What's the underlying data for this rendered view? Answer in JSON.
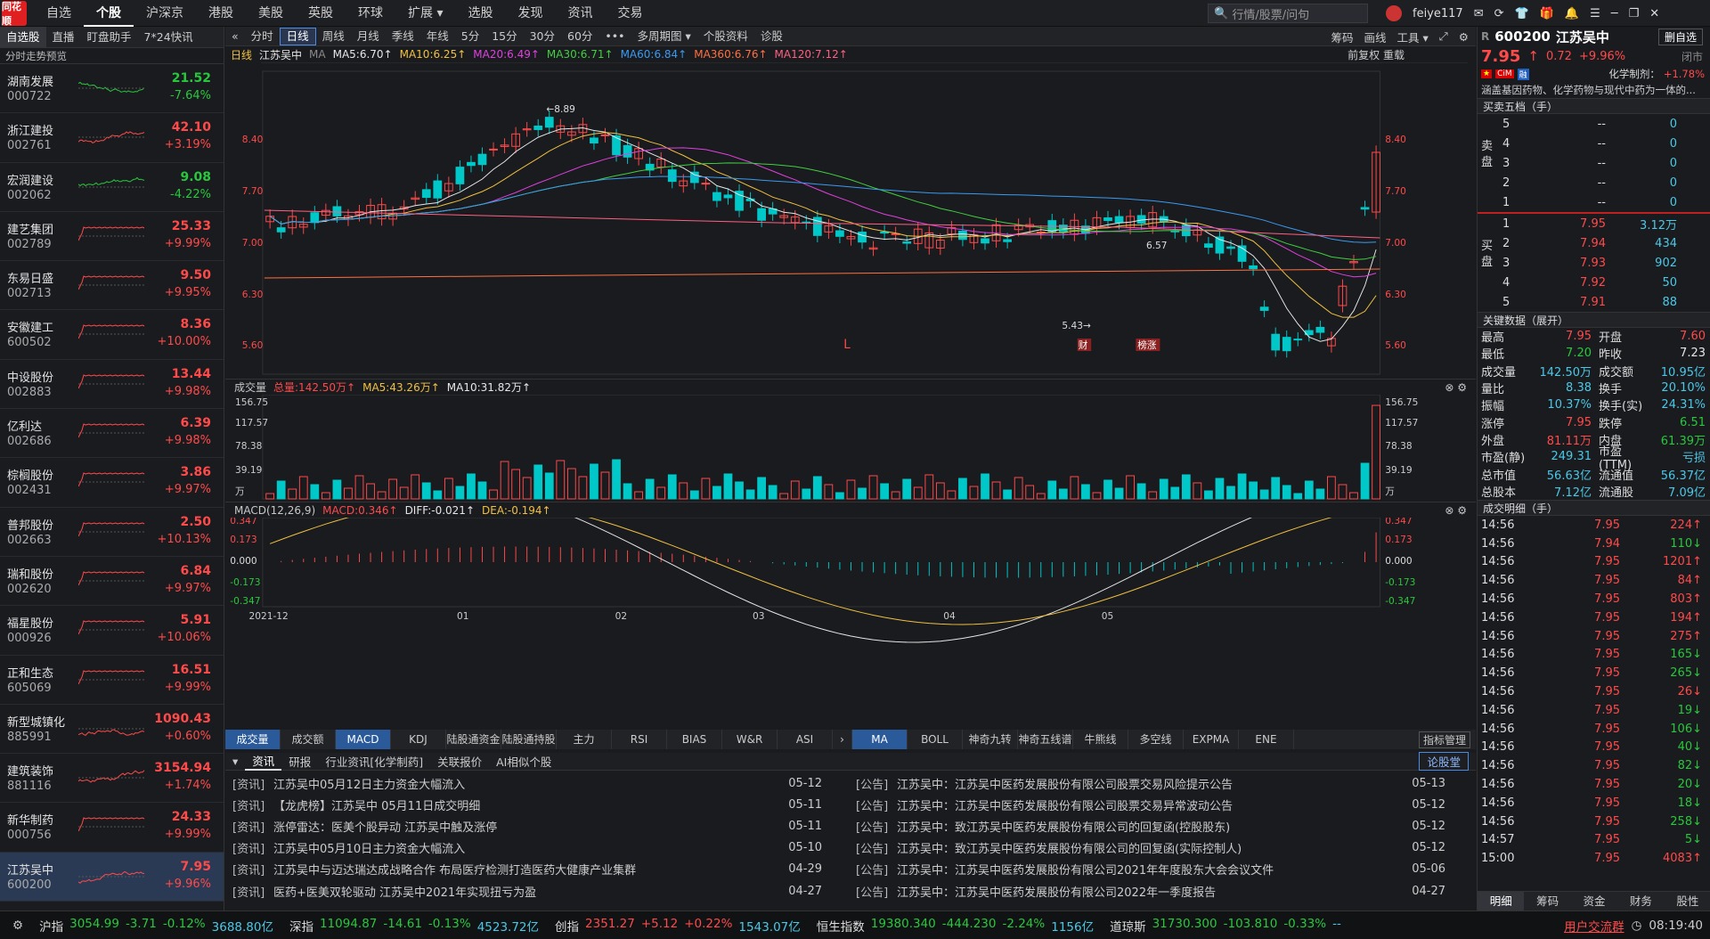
{
  "topbar": {
    "logo": "同花顺",
    "nav": [
      "自选",
      "个股",
      "沪深京",
      "港股",
      "美股",
      "英股",
      "环球",
      "扩展 ▾",
      "选股",
      "发现",
      "资讯",
      "交易"
    ],
    "search_placeholder": "行情/股票/问句",
    "user": "feiye117",
    "win_controls": [
      "─",
      "❐",
      "✕"
    ]
  },
  "left": {
    "tabs": [
      "自选股",
      "直播",
      "盯盘助手",
      "7*24快讯"
    ],
    "header": "分时走势预览",
    "stocks": [
      {
        "name": "湖南发展",
        "code": "000722",
        "price": "21.52",
        "pct": "-7.64%",
        "dir": "down"
      },
      {
        "name": "浙江建投",
        "code": "002761",
        "price": "42.10",
        "pct": "+3.19%",
        "dir": "up"
      },
      {
        "name": "宏润建设",
        "code": "002062",
        "price": "9.08",
        "pct": "-4.22%",
        "dir": "down"
      },
      {
        "name": "建艺集团",
        "code": "002789",
        "price": "25.33",
        "pct": "+9.99%",
        "dir": "up"
      },
      {
        "name": "东易日盛",
        "code": "002713",
        "price": "9.50",
        "pct": "+9.95%",
        "dir": "up"
      },
      {
        "name": "安徽建工",
        "code": "600502",
        "price": "8.36",
        "pct": "+10.00%",
        "dir": "up"
      },
      {
        "name": "中设股份",
        "code": "002883",
        "price": "13.44",
        "pct": "+9.98%",
        "dir": "up"
      },
      {
        "name": "亿利达",
        "code": "002686",
        "price": "6.39",
        "pct": "+9.98%",
        "dir": "up"
      },
      {
        "name": "棕榈股份",
        "code": "002431",
        "price": "3.86",
        "pct": "+9.97%",
        "dir": "up"
      },
      {
        "name": "普邦股份",
        "code": "002663",
        "price": "2.50",
        "pct": "+10.13%",
        "dir": "up"
      },
      {
        "name": "瑞和股份",
        "code": "002620",
        "price": "6.84",
        "pct": "+9.97%",
        "dir": "up"
      },
      {
        "name": "福星股份",
        "code": "000926",
        "price": "5.91",
        "pct": "+10.06%",
        "dir": "up"
      },
      {
        "name": "正和生态",
        "code": "605069",
        "price": "16.51",
        "pct": "+9.99%",
        "dir": "up"
      },
      {
        "name": "新型城镇化",
        "code": "885991",
        "price": "1090.43",
        "pct": "+0.60%",
        "dir": "up"
      },
      {
        "name": "建筑装饰",
        "code": "881116",
        "price": "3154.94",
        "pct": "+1.74%",
        "dir": "up"
      },
      {
        "name": "新华制药",
        "code": "000756",
        "price": "24.33",
        "pct": "+9.99%",
        "dir": "up"
      },
      {
        "name": "江苏吴中",
        "code": "600200",
        "price": "7.95",
        "pct": "+9.96%",
        "dir": "up"
      }
    ]
  },
  "center": {
    "periods": [
      "«",
      "分时",
      "日线",
      "周线",
      "月线",
      "季线",
      "年线",
      "5分",
      "15分",
      "30分",
      "60分",
      "•••",
      "多周期图 ▾",
      "个股资料",
      "诊股"
    ],
    "period_right": [
      "筹码",
      "画线",
      "工具 ▾",
      "⤢",
      "⚙"
    ],
    "ma_legend": {
      "type": "日线",
      "name": "江苏吴中",
      "ma": "MA",
      "ma5": "MA5:6.70↑",
      "ma10": "MA10:6.25↑",
      "ma20": "MA20:6.49↑",
      "ma30": "MA30:6.71↑",
      "ma60": "MA60:6.84↑",
      "ma360": "MA360:6.76↑",
      "ma120": "MA120:7.12↑",
      "right": "前复权  重载"
    },
    "price_ticks": [
      "8.40",
      "7.70",
      "7.00",
      "6.30",
      "5.60"
    ],
    "annotations": {
      "high": "←8.89",
      "low": "5.43→",
      "last": "6.57",
      "marker_l": "L",
      "tag_cai": "财",
      "tag_zt": "榜涨"
    },
    "vol_legend": {
      "name": "成交量",
      "total": "总量:142.50万↑",
      "ma5": "MA5:43.26万↑",
      "ma10": "MA10:31.82万↑"
    },
    "vol_ticks": [
      "156.75",
      "117.57",
      "78.38",
      "39.19",
      "万"
    ],
    "macd_legend": {
      "name": "MACD(12,26,9)",
      "macd": "MACD:0.346↑",
      "diff": "DIFF:-0.021↑",
      "dea": "DEA:-0.194↑"
    },
    "macd_ticks": [
      "0.347",
      "0.173",
      "0.000",
      "-0.173",
      "-0.347"
    ],
    "dates": [
      "2021-12",
      "01",
      "02",
      "03",
      "04",
      "05"
    ],
    "ind_tabs": [
      "成交量",
      "成交额",
      "MACD",
      "KDJ",
      "陆股通资金",
      "陆股通持股",
      "主力",
      "RSI",
      "BIAS",
      "W&R",
      "ASI",
      "›",
      "MA",
      "BOLL",
      "神奇九转",
      "神奇五线谱",
      "牛熊线",
      "多空线",
      "EXPMA",
      "ENE"
    ],
    "ind_manage": "指标管理",
    "news_tabs": [
      "资讯",
      "研报",
      "行业资讯[化学制药]",
      "关联报价",
      "AI相似个股"
    ],
    "news_btn": "论股堂",
    "news_left": [
      {
        "type": "[资讯]",
        "title": "江苏吴中05月12日主力资金大幅流入",
        "date": "05-12"
      },
      {
        "type": "[资讯]",
        "title": "【龙虎榜】江苏吴中 05月11日成交明细",
        "date": "05-11"
      },
      {
        "type": "[资讯]",
        "title": "涨停雷达：医美个股异动 江苏吴中触及涨停",
        "date": "05-11"
      },
      {
        "type": "[资讯]",
        "title": "江苏吴中05月10日主力资金大幅流入",
        "date": "05-10"
      },
      {
        "type": "[资讯]",
        "title": "江苏吴中与迈达瑞达成战略合作 布局医疗检测打造医药大健康产业集群",
        "date": "04-29"
      },
      {
        "type": "[资讯]",
        "title": "医药+医美双轮驱动 江苏吴中2021年实现扭亏为盈",
        "date": "04-27"
      }
    ],
    "news_right": [
      {
        "type": "[公告]",
        "title": "江苏吴中：江苏吴中医药发展股份有限公司股票交易风险提示公告",
        "date": "05-13"
      },
      {
        "type": "[公告]",
        "title": "江苏吴中：江苏吴中医药发展股份有限公司股票交易异常波动公告",
        "date": "05-12"
      },
      {
        "type": "[公告]",
        "title": "江苏吴中：致江苏吴中医药发展股份有限公司的回复函(控股股东)",
        "date": "05-12"
      },
      {
        "type": "[公告]",
        "title": "江苏吴中：致江苏吴中医药发展股份有限公司的回复函(实际控制人)",
        "date": "05-12"
      },
      {
        "type": "[公告]",
        "title": "江苏吴中：江苏吴中医药发展股份有限公司2021年年度股东大会会议文件",
        "date": "05-06"
      },
      {
        "type": "[公告]",
        "title": "江苏吴中：江苏吴中医药发展股份有限公司2022年一季度报告",
        "date": "04-27"
      }
    ]
  },
  "right": {
    "code": "600200",
    "name": "江苏吴中",
    "r": "R",
    "btn_del": "删自选",
    "price": "7.95",
    "arrow": "↑",
    "chg": "0.72",
    "pct": "+9.96%",
    "status": "闭市",
    "industry": "化学制剂：",
    "industry_pct": "+1.78%",
    "desc": "涵盖基因药物、化学药物与现代中药为一体的...",
    "sec_ob": "买卖五档（手）",
    "asks": [
      {
        "n": "5",
        "p": "--",
        "v": "0"
      },
      {
        "n": "4",
        "p": "--",
        "v": "0"
      },
      {
        "n": "3",
        "p": "--",
        "v": "0"
      },
      {
        "n": "2",
        "p": "--",
        "v": "0"
      },
      {
        "n": "1",
        "p": "--",
        "v": "0"
      }
    ],
    "bids": [
      {
        "n": "1",
        "p": "7.95",
        "v": "3.12万"
      },
      {
        "n": "2",
        "p": "7.94",
        "v": "434"
      },
      {
        "n": "3",
        "p": "7.93",
        "v": "902"
      },
      {
        "n": "4",
        "p": "7.92",
        "v": "50"
      },
      {
        "n": "5",
        "p": "7.91",
        "v": "88"
      }
    ],
    "ask_label": "卖盘",
    "bid_label": "买盘",
    "sec_key": "关键数据（展开）",
    "key": [
      [
        "最高",
        "7.95",
        "red",
        "开盘",
        "7.60",
        "red"
      ],
      [
        "最低",
        "7.20",
        "green",
        "昨收",
        "7.23",
        "white"
      ],
      [
        "成交量",
        "142.50万",
        "cyan",
        "成交额",
        "10.95亿",
        "cyan"
      ],
      [
        "量比",
        "8.38",
        "cyan",
        "换手",
        "20.10%",
        "cyan"
      ],
      [
        "振幅",
        "10.37%",
        "cyan",
        "换手(实)",
        "24.31%",
        "cyan"
      ],
      [
        "涨停",
        "7.95",
        "red",
        "跌停",
        "6.51",
        "green"
      ],
      [
        "外盘",
        "81.11万",
        "red",
        "内盘",
        "61.39万",
        "green"
      ],
      [
        "市盈(静)",
        "249.31",
        "cyan",
        "市盈(TTM)",
        "亏损",
        "cyan"
      ],
      [
        "总市值",
        "56.63亿",
        "cyan",
        "流通值",
        "56.37亿",
        "cyan"
      ],
      [
        "总股本",
        "7.12亿",
        "cyan",
        "流通股",
        "7.09亿",
        "cyan"
      ]
    ],
    "sec_tick": "成交明细（手）",
    "ticks": [
      [
        "14:56",
        "7.95",
        "224↑",
        "red"
      ],
      [
        "14:56",
        "7.94",
        "110↓",
        "green"
      ],
      [
        "14:56",
        "7.95",
        "1201↑",
        "red"
      ],
      [
        "14:56",
        "7.95",
        "84↑",
        "red"
      ],
      [
        "14:56",
        "7.95",
        "803↑",
        "red"
      ],
      [
        "14:56",
        "7.95",
        "194↑",
        "red"
      ],
      [
        "14:56",
        "7.95",
        "275↑",
        "red"
      ],
      [
        "14:56",
        "7.95",
        "165↓",
        "green"
      ],
      [
        "14:56",
        "7.95",
        "265↓",
        "green"
      ],
      [
        "14:56",
        "7.95",
        "26↓",
        "red"
      ],
      [
        "14:56",
        "7.95",
        "19↓",
        "green"
      ],
      [
        "14:56",
        "7.95",
        "106↓",
        "green"
      ],
      [
        "14:56",
        "7.95",
        "40↓",
        "green"
      ],
      [
        "14:56",
        "7.95",
        "82↓",
        "green"
      ],
      [
        "14:56",
        "7.95",
        "20↓",
        "green"
      ],
      [
        "14:56",
        "7.95",
        "18↓",
        "green"
      ],
      [
        "14:56",
        "7.95",
        "258↓",
        "green"
      ],
      [
        "14:57",
        "7.95",
        "5↓",
        "green"
      ],
      [
        "15:00",
        "7.95",
        "4083↑",
        "red"
      ]
    ],
    "bottom_tabs": [
      "明细",
      "筹码",
      "资金",
      "财务",
      "股性"
    ]
  },
  "bottom": {
    "indices": [
      {
        "name": "沪指",
        "v": "3054.99",
        "c": "-3.71",
        "p": "-0.12%",
        "a": "3688.80亿",
        "dir": "down"
      },
      {
        "name": "深指",
        "v": "11094.87",
        "c": "-14.61",
        "p": "-0.13%",
        "a": "4523.72亿",
        "dir": "down"
      },
      {
        "name": "创指",
        "v": "2351.27",
        "c": "+5.12",
        "p": "+0.22%",
        "a": "1543.07亿",
        "dir": "up"
      },
      {
        "name": "恒生指数",
        "v": "19380.340",
        "c": "-444.230",
        "p": "-2.24%",
        "a": "1156亿",
        "dir": "down"
      },
      {
        "name": "道琼斯",
        "v": "31730.300",
        "c": "-103.810",
        "p": "-0.33%",
        "a": "--",
        "dir": "down"
      }
    ],
    "community": "用户交流群",
    "time": "08:19:40"
  },
  "colors": {
    "up": "#ff4a4a",
    "down": "#28c83c",
    "bg": "#1a1b1f"
  }
}
